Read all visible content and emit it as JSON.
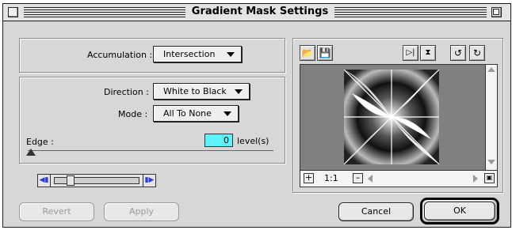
{
  "window": {
    "title": "Gradient Mask Settings"
  },
  "accumulation": {
    "label": "Accumulation :",
    "value": "Intersection"
  },
  "direction": {
    "label": "Direction :",
    "value": "White to Black"
  },
  "mode": {
    "label": "Mode :",
    "value": "All To None"
  },
  "edge": {
    "label": "Edge :",
    "value": "0",
    "unit": "level(s)"
  },
  "preview": {
    "zoom": "1:1"
  },
  "buttons": {
    "revert": "Revert",
    "apply": "Apply",
    "cancel": "Cancel",
    "ok": "OK"
  },
  "icons": [
    "open-folder-icon",
    "save-disk-icon",
    "flip-horizontal-icon",
    "flip-vertical-icon",
    "rotate-left-icon",
    "rotate-right-icon",
    "zoom-in-icon",
    "zoom-out-icon",
    "grow-box-icon"
  ],
  "colors": {
    "edge_field_bg": "#5ef2ff",
    "window_bg": "#d7d7d7"
  }
}
